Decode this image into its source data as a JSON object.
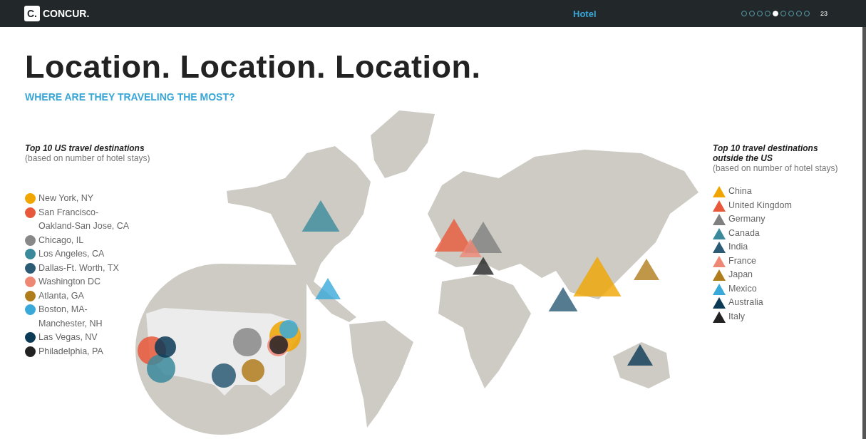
{
  "header": {
    "logo_mark": "C.",
    "logo_text": "CONCUR.",
    "section": "Hotel",
    "pages": [
      {
        "selected": false
      },
      {
        "selected": false
      },
      {
        "selected": false
      },
      {
        "selected": false
      },
      {
        "selected": true
      },
      {
        "selected": false
      },
      {
        "selected": false
      },
      {
        "selected": false
      },
      {
        "selected": false
      }
    ],
    "page_number": "23"
  },
  "title": "Location. Location. Location.",
  "subtitle": "WHERE ARE THEY TRAVELING THE MOST?",
  "us_legend": {
    "title": "Top 10 US travel destinations",
    "note": "(based on number of hotel stays)",
    "items": [
      {
        "label": "New York, NY",
        "color": "#f0a500"
      },
      {
        "label": "San Francisco-Oakland-San Jose, CA",
        "color": "#e8583a"
      },
      {
        "label": "Chicago, IL",
        "color": "#888888"
      },
      {
        "label": "Los Angeles, CA",
        "color": "#3b8a9c"
      },
      {
        "label": "Dallas-Ft. Worth, TX",
        "color": "#2a5a74"
      },
      {
        "label": "Washington DC",
        "color": "#ef8775"
      },
      {
        "label": "Atlanta, GA",
        "color": "#b07d1c"
      },
      {
        "label": "Boston, MA-Manchester, NH",
        "color": "#38a9d9"
      },
      {
        "label": "Las Vegas, NV",
        "color": "#0b3a57"
      },
      {
        "label": "Philadelphia, PA",
        "color": "#222222"
      }
    ]
  },
  "world_legend": {
    "title": "Top 10 travel destinations outside the US",
    "note": "(based on number of hotel stays)",
    "items": [
      {
        "label": "China",
        "color": "#f0a500"
      },
      {
        "label": "United Kingdom",
        "color": "#e8583a"
      },
      {
        "label": "Germany",
        "color": "#808080"
      },
      {
        "label": "Canada",
        "color": "#3b8a9c"
      },
      {
        "label": "India",
        "color": "#2a5a74"
      },
      {
        "label": "France",
        "color": "#ef8775"
      },
      {
        "label": "Japan",
        "color": "#b07d1c"
      },
      {
        "label": "Mexico",
        "color": "#38a9d9"
      },
      {
        "label": "Australia",
        "color": "#0b3a57"
      },
      {
        "label": "Italy",
        "color": "#222222"
      }
    ]
  }
}
